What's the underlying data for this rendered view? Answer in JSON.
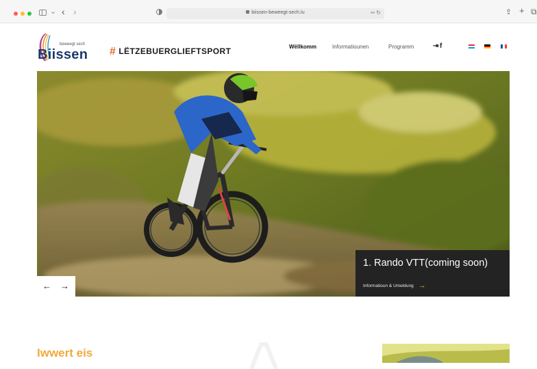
{
  "browser": {
    "url": "biissen-beweegt-sech.lu",
    "back": "‹",
    "forward": "›",
    "sidebar_chevron": "⌄",
    "ext_icon": "⚯",
    "reload": "↻",
    "share": "⇪",
    "new_tab": "+",
    "tabs_icon": "⧉"
  },
  "header": {
    "logo_small": "beweegt sech",
    "logo_word": "Biissen",
    "tagline_hash": "#",
    "tagline": "LËTZEBUERGLIEFTSPORT",
    "nav": [
      {
        "label": "Wëllkomm",
        "active": true
      },
      {
        "label": "Informatiounen",
        "active": false
      },
      {
        "label": "Programm",
        "active": false
      }
    ],
    "login_icon": "⇥",
    "facebook_icon": "f",
    "flags": [
      "lu",
      "de",
      "fr"
    ]
  },
  "hero": {
    "caption_title": "1. Rando VTT(coming soon)",
    "caption_link": "Informatioun & Umeldung",
    "caption_arrow": "→",
    "prev": "←",
    "next": "→"
  },
  "section": {
    "title": "Iwwert eis"
  },
  "colors": {
    "accent": "#f0a93b",
    "logo_blue": "#1b3a6b",
    "caption_bg": "#232323"
  }
}
